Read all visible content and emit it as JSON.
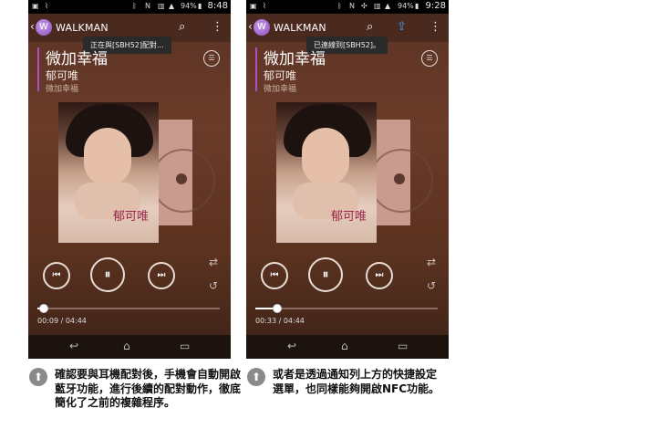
{
  "app_title": "WALKMAN",
  "screens": [
    {
      "status_battery": "94%",
      "status_time": "8:48",
      "toast": "正在與[SBH52]配對...",
      "song_title": "微加幸福",
      "artist": "郁可唯",
      "album": "微加幸福",
      "cover_signature": "郁可唯",
      "elapsed": "00:09 / 04:44",
      "progress_fraction": 0.032
    },
    {
      "status_battery": "94%",
      "status_time": "9:28",
      "toast": "已連線到[SBH52]。",
      "song_title": "微加幸福",
      "artist": "郁可唯",
      "album": "微加幸福",
      "cover_signature": "郁可唯",
      "elapsed": "00:33 / 04:44",
      "progress_fraction": 0.116
    }
  ],
  "captions": [
    "確認要與耳機配對後，手機會自動開啟藍牙功能，進行後續的配對動作，徹底簡化了之前的複雜程序。",
    "或者是透過通知列上方的快捷設定選單，也同樣能夠開啟NFC功能。"
  ],
  "icons": {
    "search": "search-icon",
    "overflow": "overflow-menu-icon",
    "share": "share-upload-icon",
    "prev": "previous-track-icon",
    "pause": "pause-icon",
    "next": "next-track-icon",
    "repeat": "repeat-icon",
    "shuffle": "shuffle-icon",
    "back": "back-icon",
    "home": "home-icon",
    "recents": "recent-apps-icon",
    "caption": "arrow-up-circle-icon"
  },
  "colors": {
    "accent": "#b04ec4",
    "background_top": "#5a3324"
  }
}
